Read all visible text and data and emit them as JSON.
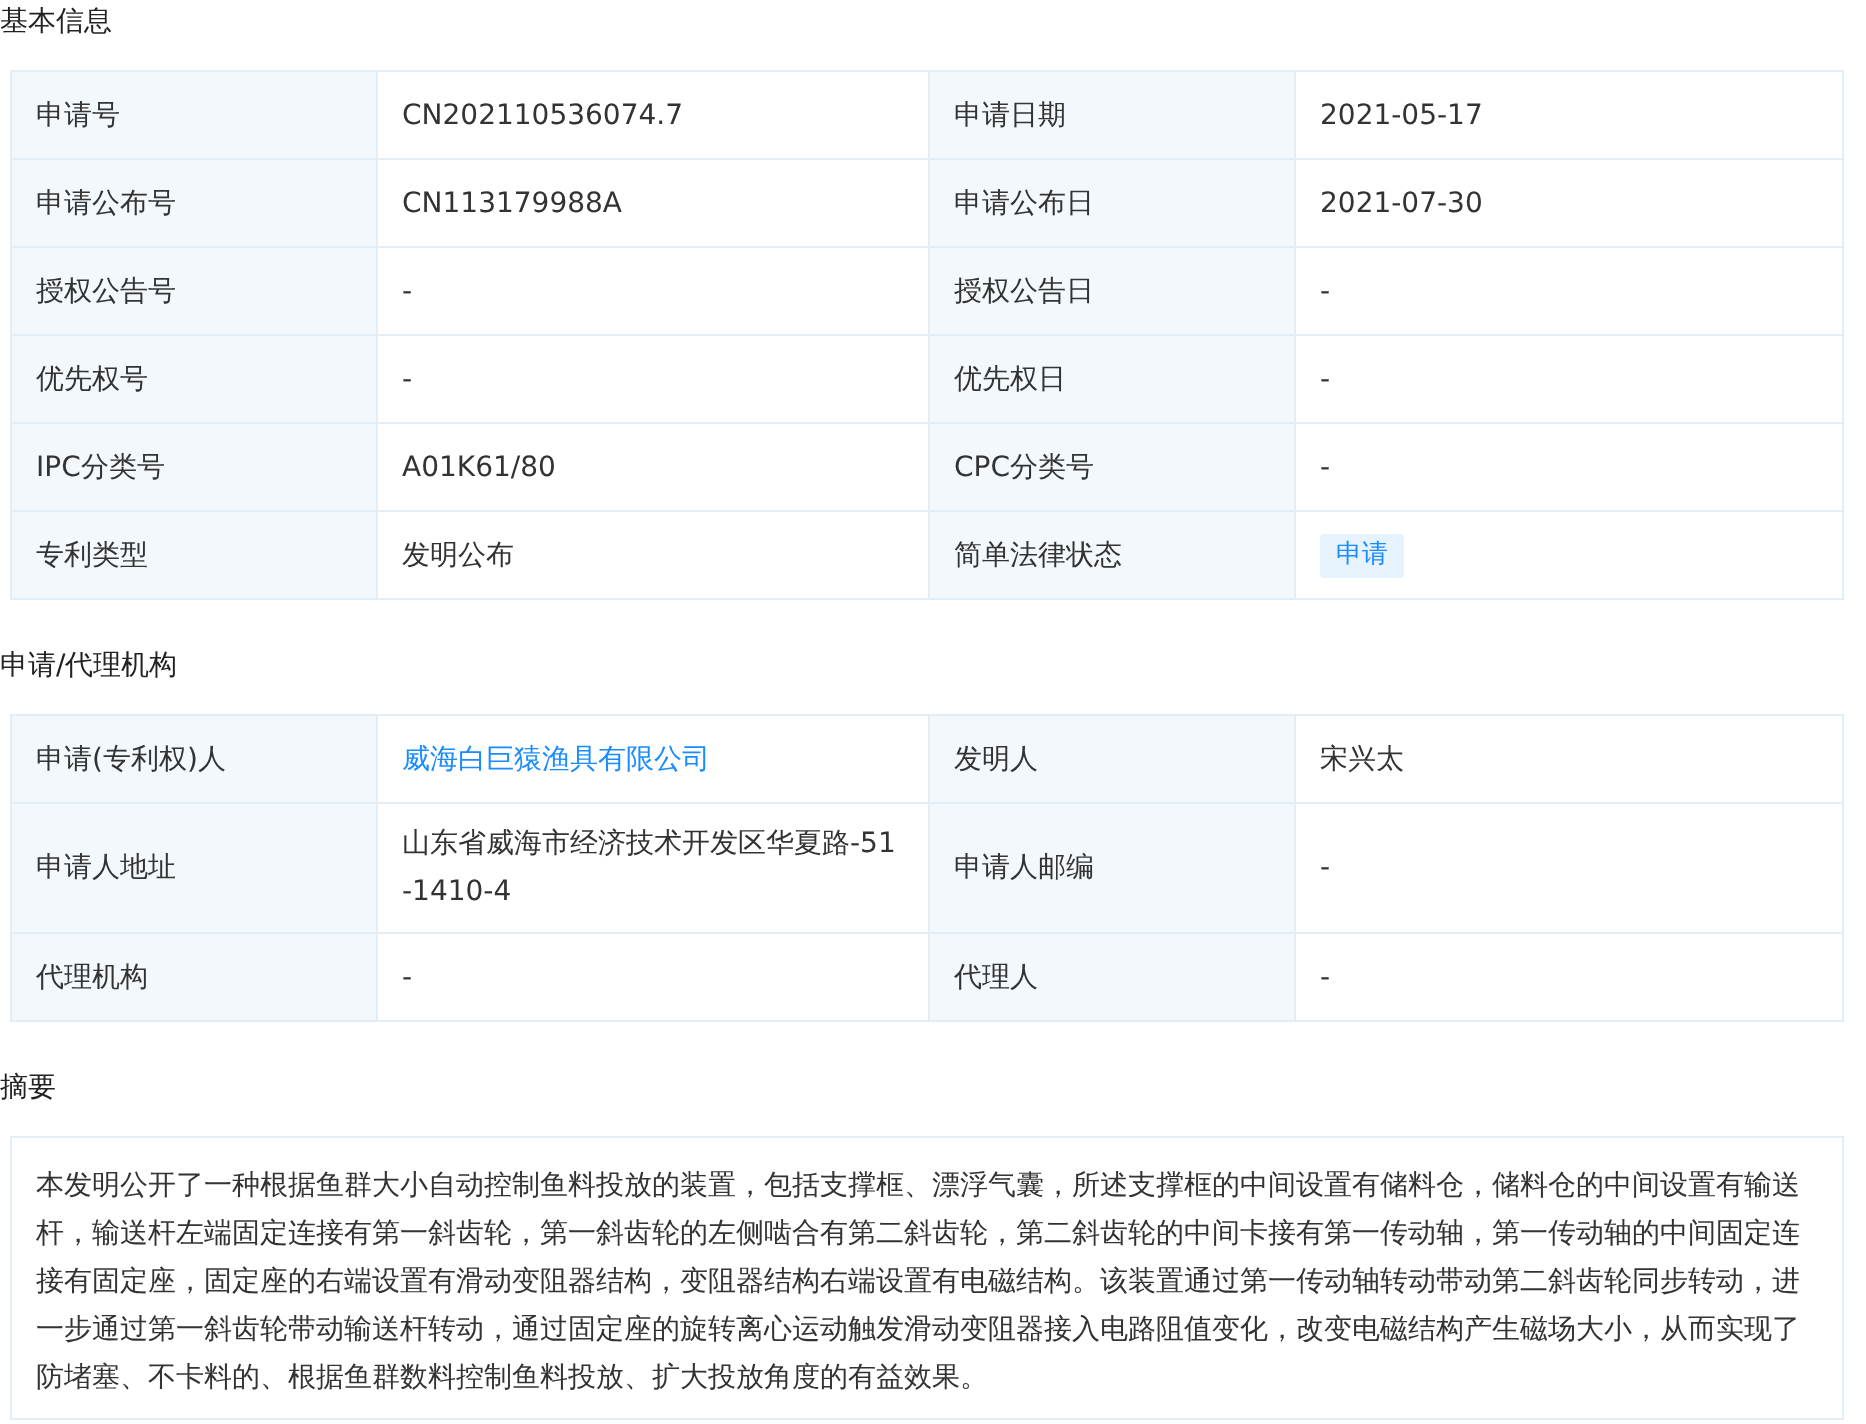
{
  "sections": [
    {
      "kind": "table",
      "title": "基本信息",
      "rows": [
        [
          {
            "label": "申请号",
            "value": "CN202110536074.7",
            "kind": "text"
          },
          {
            "label": "申请日期",
            "value": "2021-05-17",
            "kind": "text"
          }
        ],
        [
          {
            "label": "申请公布号",
            "value": "CN113179988A",
            "kind": "text"
          },
          {
            "label": "申请公布日",
            "value": "2021-07-30",
            "kind": "text"
          }
        ],
        [
          {
            "label": "授权公告号",
            "value": "-",
            "kind": "text"
          },
          {
            "label": "授权公告日",
            "value": "-",
            "kind": "text"
          }
        ],
        [
          {
            "label": "优先权号",
            "value": "-",
            "kind": "text"
          },
          {
            "label": "优先权日",
            "value": "-",
            "kind": "text"
          }
        ],
        [
          {
            "label": "IPC分类号",
            "value": "A01K61/80",
            "kind": "text"
          },
          {
            "label": "CPC分类号",
            "value": "-",
            "kind": "text"
          }
        ],
        [
          {
            "label": "专利类型",
            "value": "发明公布",
            "kind": "text"
          },
          {
            "label": "简单法律状态",
            "value": "申请",
            "kind": "tag"
          }
        ]
      ]
    },
    {
      "kind": "table",
      "title": "申请/代理机构",
      "rows": [
        [
          {
            "label": "申请(专利权)人",
            "value": "威海白巨猿渔具有限公司",
            "kind": "link"
          },
          {
            "label": "发明人",
            "value": "宋兴太",
            "kind": "text"
          }
        ],
        [
          {
            "label": "申请人地址",
            "value": "山东省威海市经济技术开发区华夏路-51-1410-4",
            "kind": "text"
          },
          {
            "label": "申请人邮编",
            "value": "-",
            "kind": "text"
          }
        ],
        [
          {
            "label": "代理机构",
            "value": "-",
            "kind": "text"
          },
          {
            "label": "代理人",
            "value": "-",
            "kind": "text"
          }
        ]
      ]
    },
    {
      "kind": "text",
      "title": "摘要",
      "text": "本发明公开了一种根据鱼群大小自动控制鱼料投放的装置，包括支撑框、漂浮气囊，所述支撑框的中间设置有储料仓，储料仓的中间设置有输送杆，输送杆左端固定连接有第一斜齿轮，第一斜齿轮的左侧啮合有第二斜齿轮，第二斜齿轮的中间卡接有第一传动轴，第一传动轴的中间固定连接有固定座，固定座的右端设置有滑动变阻器结构，变阻器结构右端设置有电磁结构。该装置通过第一传动轴转动带动第二斜齿轮同步转动，进一步通过第一斜齿轮带动输送杆转动，通过固定座的旋转离心运动触发滑动变阻器接入电路阻值变化，改变电磁结构产生磁场大小，从而实现了防堵塞、不卡料的、根据鱼群数料控制鱼料投放、扩大投放角度的有益效果。"
    }
  ]
}
